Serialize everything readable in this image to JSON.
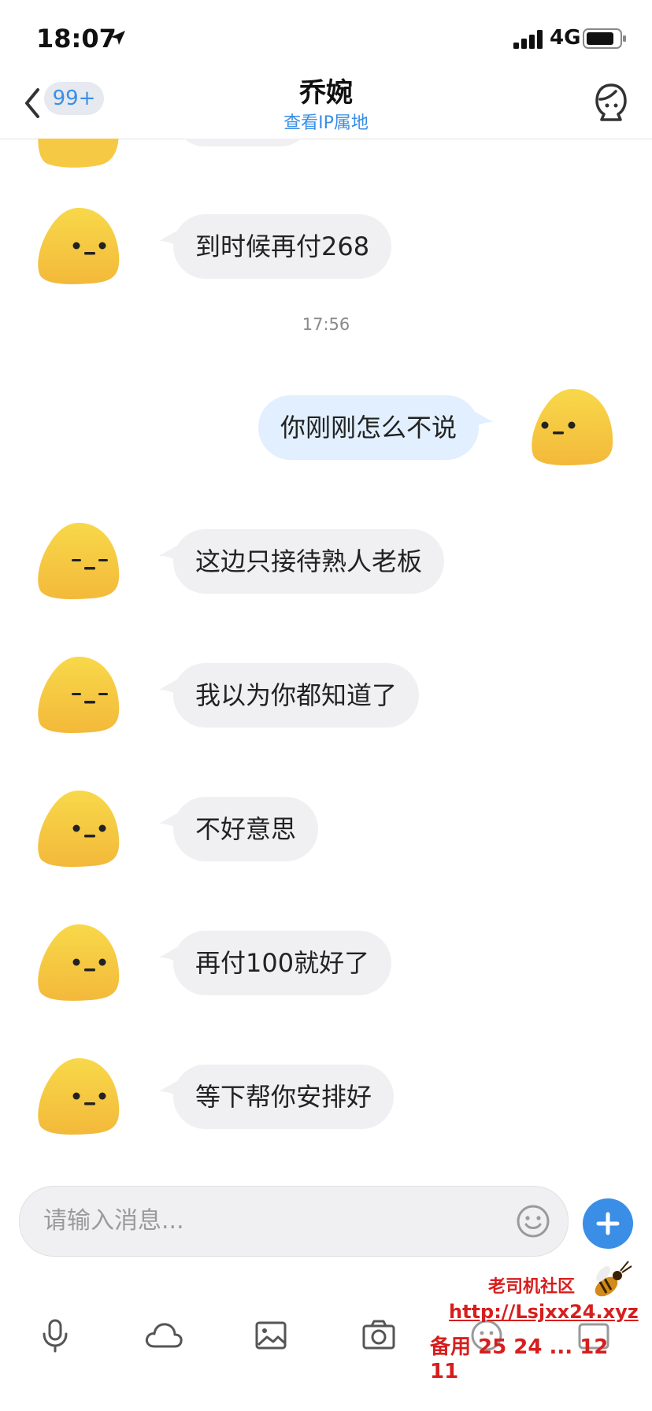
{
  "status_bar": {
    "time": "18:07",
    "network": "4G"
  },
  "header": {
    "badge": "99+",
    "title": "乔婉",
    "subtitle": "查看IP属地"
  },
  "messages": [
    {
      "text": "到时候再付268",
      "from": "other"
    },
    {
      "text": "你刚刚怎么不说",
      "from": "me"
    },
    {
      "text": "这边只接待熟人老板",
      "from": "other"
    },
    {
      "text": "我以为你都知道了",
      "from": "other"
    },
    {
      "text": "不好意思",
      "from": "other"
    },
    {
      "text": "再付100就好了",
      "from": "other"
    },
    {
      "text": "等下帮你安排好",
      "from": "other"
    }
  ],
  "timestamp": "17:56",
  "input": {
    "placeholder": "请输入消息..."
  },
  "watermark": {
    "line1": "老司机社区",
    "line2": "http://Lsjxx24.xyz",
    "line3": "备用 25 24 ... 12 11"
  },
  "colors": {
    "accent": "#3a8ee6",
    "bubble_other": "#f0f0f3",
    "bubble_mine": "#e1effe",
    "avatar": "#f6c944"
  }
}
